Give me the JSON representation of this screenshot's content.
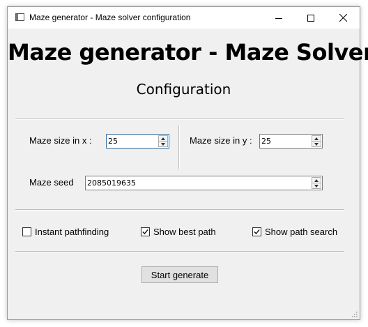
{
  "window": {
    "title": "Maze generator - Maze solver configuration"
  },
  "header": {
    "title": "Maze generator - Maze Solver",
    "subtitle": "Configuration"
  },
  "fields": {
    "size_x_label": "Maze size in x :",
    "size_x_value": "25",
    "size_y_label": "Maze size in y :",
    "size_y_value": "25",
    "seed_label": "Maze seed",
    "seed_value": "2085019635"
  },
  "options": [
    {
      "label": "Instant pathfinding",
      "checked": false
    },
    {
      "label": "Show best path",
      "checked": true
    },
    {
      "label": "Show path search",
      "checked": true
    }
  ],
  "actions": {
    "start_label": "Start generate"
  }
}
